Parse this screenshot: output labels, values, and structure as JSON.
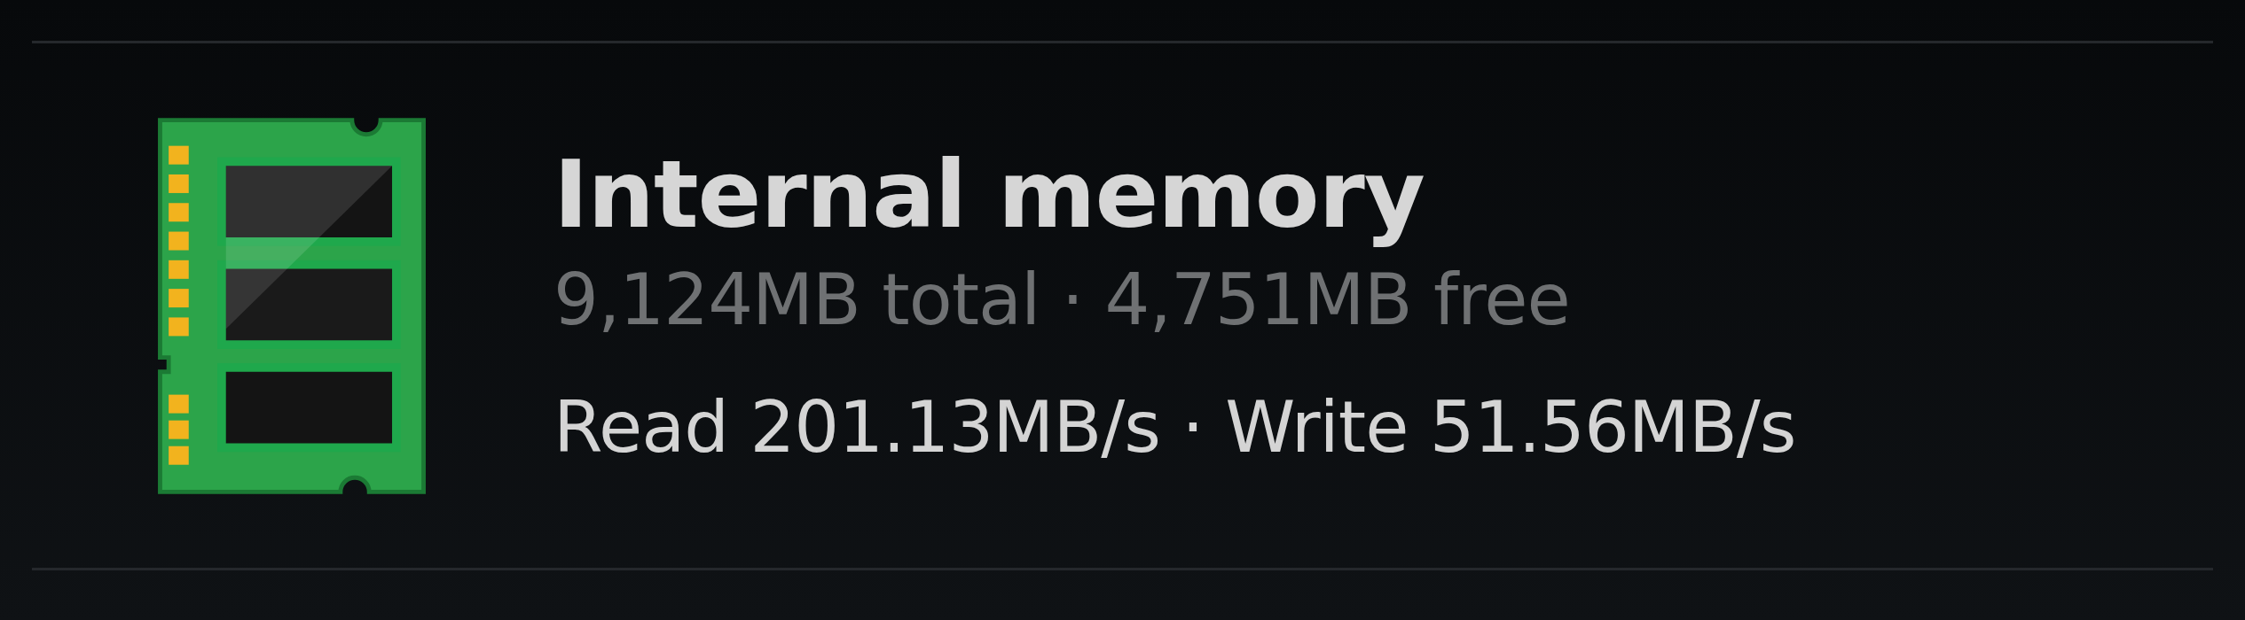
{
  "storage_item": {
    "title": "Internal memory",
    "summary": "9,124MB total · 4,751MB free",
    "speed": "Read 201.13MB/s · Write 51.56MB/s"
  }
}
